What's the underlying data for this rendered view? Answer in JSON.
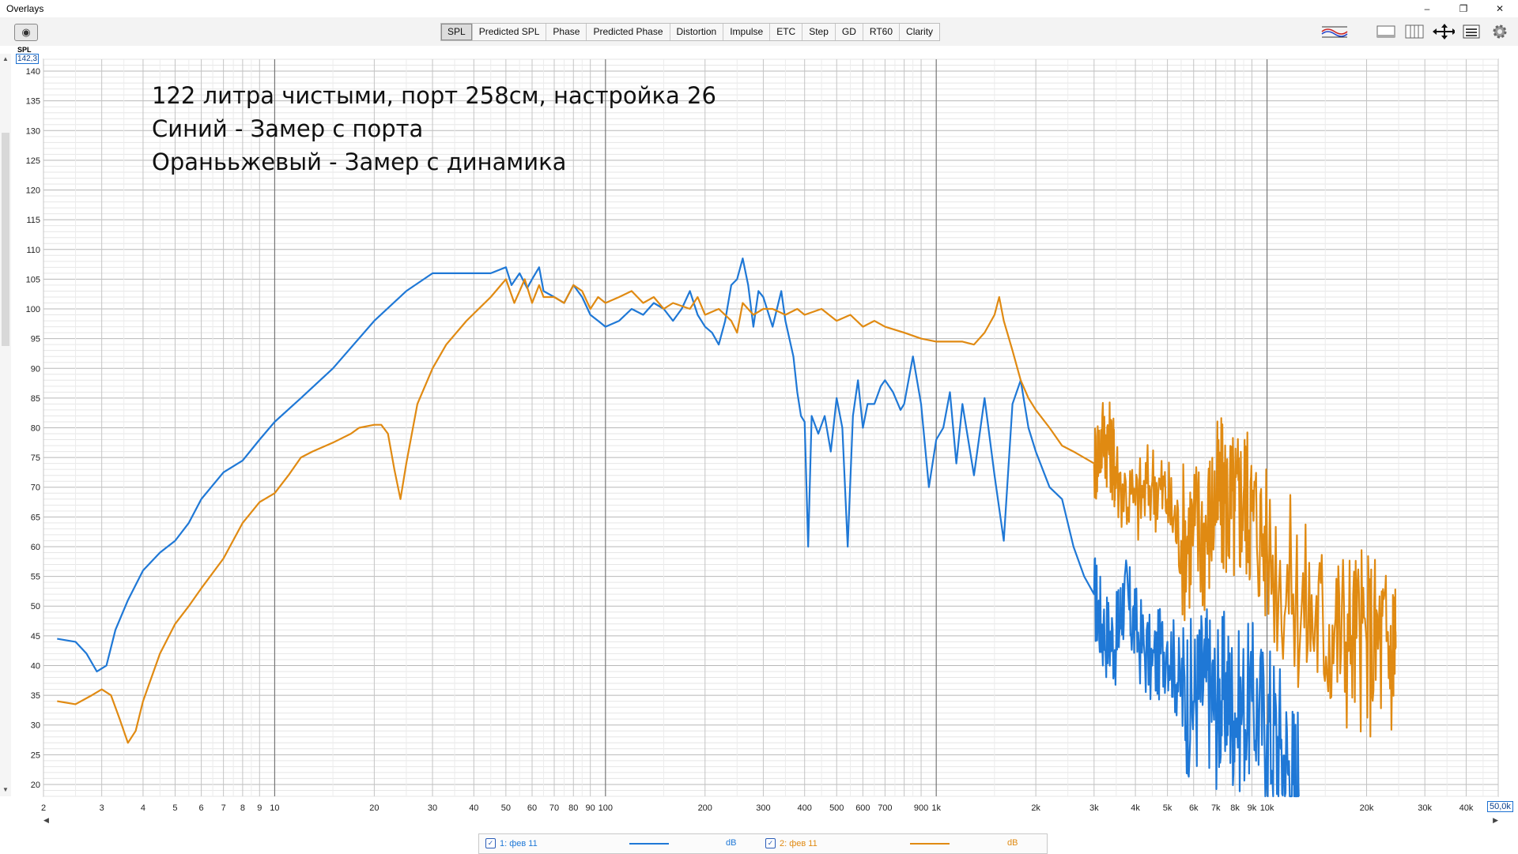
{
  "window": {
    "title": "Overlays",
    "controls": [
      "–",
      "❐",
      "✕"
    ]
  },
  "tabs": [
    {
      "label": "SPL",
      "active": true
    },
    {
      "label": "Predicted SPL"
    },
    {
      "label": "Phase"
    },
    {
      "label": "Predicted Phase"
    },
    {
      "label": "Distortion"
    },
    {
      "label": "Impulse"
    },
    {
      "label": "ETC"
    },
    {
      "label": "Step"
    },
    {
      "label": "GD"
    },
    {
      "label": "RT60"
    },
    {
      "label": "Clarity"
    }
  ],
  "toolbar_icons": [
    "graph-controls-icon",
    "limits-icon",
    "columns-icon",
    "pan-zoom-icon",
    "menu-icon",
    "settings-gear-icon"
  ],
  "y_axis": {
    "label": "SPL",
    "current_max": "142,3"
  },
  "x_axis": {
    "current_max": "50,0k"
  },
  "annotation": [
    "122 литра чистыми, порт 258см, настройка 26",
    "Синий - Замер с порта",
    "Оранььжевый - Замер с динамика"
  ],
  "legend": [
    {
      "label": "1: фев 11",
      "unit": "dB",
      "color": "#1f78d6",
      "checked": true
    },
    {
      "label": "2: фев 11",
      "unit": "dB",
      "color": "#e08a12",
      "checked": true
    }
  ],
  "chart_data": {
    "type": "line",
    "xscale": "log",
    "xlim": [
      2,
      50000
    ],
    "ylim": [
      18,
      142
    ],
    "grid": true,
    "yticks": [
      20,
      25,
      30,
      35,
      40,
      45,
      50,
      55,
      60,
      65,
      70,
      75,
      80,
      85,
      90,
      95,
      100,
      105,
      110,
      115,
      120,
      125,
      130,
      135,
      140
    ],
    "xticks": [
      {
        "v": 2,
        "label": "2"
      },
      {
        "v": 3,
        "label": "3"
      },
      {
        "v": 4,
        "label": "4"
      },
      {
        "v": 5,
        "label": "5"
      },
      {
        "v": 6,
        "label": "6"
      },
      {
        "v": 7,
        "label": "7"
      },
      {
        "v": 8,
        "label": "8"
      },
      {
        "v": 9,
        "label": "9"
      },
      {
        "v": 10,
        "label": "10"
      },
      {
        "v": 20,
        "label": "20"
      },
      {
        "v": 30,
        "label": "30"
      },
      {
        "v": 40,
        "label": "40"
      },
      {
        "v": 50,
        "label": "50"
      },
      {
        "v": 60,
        "label": "60"
      },
      {
        "v": 70,
        "label": "70"
      },
      {
        "v": 80,
        "label": "80"
      },
      {
        "v": 90,
        "label": "90"
      },
      {
        "v": 100,
        "label": "100"
      },
      {
        "v": 200,
        "label": "200"
      },
      {
        "v": 300,
        "label": "300"
      },
      {
        "v": 400,
        "label": "400"
      },
      {
        "v": 500,
        "label": "500"
      },
      {
        "v": 600,
        "label": "600"
      },
      {
        "v": 700,
        "label": "700"
      },
      {
        "v": 900,
        "label": "900"
      },
      {
        "v": 1000,
        "label": "1k"
      },
      {
        "v": 2000,
        "label": "2k"
      },
      {
        "v": 3000,
        "label": "3k"
      },
      {
        "v": 4000,
        "label": "4k"
      },
      {
        "v": 5000,
        "label": "5k"
      },
      {
        "v": 6000,
        "label": "6k"
      },
      {
        "v": 7000,
        "label": "7k"
      },
      {
        "v": 8000,
        "label": "8k"
      },
      {
        "v": 9000,
        "label": "9k"
      },
      {
        "v": 10000,
        "label": "10k"
      },
      {
        "v": 20000,
        "label": "20k"
      },
      {
        "v": 30000,
        "label": "30k"
      },
      {
        "v": 40000,
        "label": "40k"
      }
    ],
    "series": [
      {
        "name": "1: фев 11",
        "color": "#1f78d6",
        "points": [
          [
            2.2,
            44.5
          ],
          [
            2.5,
            44
          ],
          [
            2.7,
            42
          ],
          [
            2.9,
            39
          ],
          [
            3.1,
            40
          ],
          [
            3.3,
            46
          ],
          [
            3.6,
            51
          ],
          [
            4,
            56
          ],
          [
            4.5,
            59
          ],
          [
            5,
            61
          ],
          [
            5.5,
            64
          ],
          [
            6,
            68
          ],
          [
            7,
            72.5
          ],
          [
            8,
            74.5
          ],
          [
            9,
            78
          ],
          [
            10,
            81
          ],
          [
            12,
            85
          ],
          [
            15,
            90
          ],
          [
            20,
            98
          ],
          [
            25,
            103
          ],
          [
            30,
            106
          ],
          [
            40,
            106
          ],
          [
            45,
            106
          ],
          [
            50,
            107
          ],
          [
            52,
            104
          ],
          [
            55,
            106
          ],
          [
            58,
            103.5
          ],
          [
            60,
            105
          ],
          [
            63,
            107
          ],
          [
            65,
            103
          ],
          [
            70,
            102
          ],
          [
            75,
            101
          ],
          [
            80,
            104
          ],
          [
            85,
            102
          ],
          [
            90,
            99
          ],
          [
            95,
            98
          ],
          [
            100,
            97
          ],
          [
            110,
            98
          ],
          [
            120,
            100
          ],
          [
            130,
            99
          ],
          [
            140,
            101
          ],
          [
            150,
            100
          ],
          [
            160,
            98
          ],
          [
            170,
            100
          ],
          [
            180,
            103
          ],
          [
            190,
            99
          ],
          [
            200,
            97
          ],
          [
            210,
            96
          ],
          [
            220,
            94
          ],
          [
            230,
            98
          ],
          [
            240,
            104
          ],
          [
            250,
            105
          ],
          [
            260,
            108.5
          ],
          [
            270,
            104
          ],
          [
            280,
            97
          ],
          [
            290,
            103
          ],
          [
            300,
            102
          ],
          [
            320,
            97
          ],
          [
            340,
            103
          ],
          [
            350,
            98
          ],
          [
            370,
            92
          ],
          [
            380,
            86
          ],
          [
            390,
            82
          ],
          [
            400,
            81
          ],
          [
            410,
            60
          ],
          [
            420,
            82
          ],
          [
            440,
            79
          ],
          [
            460,
            82
          ],
          [
            480,
            76
          ],
          [
            500,
            85
          ],
          [
            520,
            80
          ],
          [
            540,
            60
          ],
          [
            560,
            82
          ],
          [
            580,
            88
          ],
          [
            600,
            80
          ],
          [
            620,
            84
          ],
          [
            650,
            84
          ],
          [
            680,
            87
          ],
          [
            700,
            88
          ],
          [
            740,
            86
          ],
          [
            780,
            83
          ],
          [
            800,
            84
          ],
          [
            850,
            92
          ],
          [
            900,
            84
          ],
          [
            950,
            70
          ],
          [
            1000,
            78
          ],
          [
            1050,
            80
          ],
          [
            1100,
            86
          ],
          [
            1150,
            74
          ],
          [
            1200,
            84
          ],
          [
            1300,
            72
          ],
          [
            1400,
            85
          ],
          [
            1500,
            72
          ],
          [
            1600,
            61
          ],
          [
            1700,
            84
          ],
          [
            1800,
            88
          ],
          [
            1900,
            80
          ],
          [
            2000,
            76
          ],
          [
            2200,
            70
          ],
          [
            2400,
            68
          ],
          [
            2600,
            60
          ],
          [
            2800,
            55
          ],
          [
            3000,
            52
          ],
          [
            3200,
            46
          ],
          [
            3500,
            44
          ],
          [
            3700,
            52
          ],
          [
            4000,
            46
          ],
          [
            4500,
            40
          ],
          [
            5000,
            44
          ],
          [
            5500,
            36
          ],
          [
            6000,
            34
          ],
          [
            6500,
            38
          ],
          [
            7000,
            33
          ],
          [
            7500,
            36
          ],
          [
            8000,
            32
          ],
          [
            9000,
            34
          ],
          [
            10000,
            30
          ],
          [
            11000,
            26
          ],
          [
            12000,
            20
          ],
          [
            12500,
            18
          ]
        ]
      },
      {
        "name": "2: фев 11",
        "color": "#e08a12",
        "points": [
          [
            2.2,
            34
          ],
          [
            2.5,
            33.5
          ],
          [
            2.8,
            35
          ],
          [
            3,
            36
          ],
          [
            3.2,
            35
          ],
          [
            3.4,
            31
          ],
          [
            3.6,
            27
          ],
          [
            3.8,
            29
          ],
          [
            4,
            34
          ],
          [
            4.5,
            42
          ],
          [
            5,
            47
          ],
          [
            5.5,
            50
          ],
          [
            6,
            53
          ],
          [
            7,
            58
          ],
          [
            8,
            64
          ],
          [
            9,
            67.5
          ],
          [
            10,
            69
          ],
          [
            11,
            72
          ],
          [
            12,
            75
          ],
          [
            13,
            76
          ],
          [
            15,
            77.5
          ],
          [
            17,
            79
          ],
          [
            18,
            80
          ],
          [
            20,
            80.5
          ],
          [
            21,
            80.5
          ],
          [
            22,
            79
          ],
          [
            23,
            73
          ],
          [
            24,
            68
          ],
          [
            25,
            74
          ],
          [
            27,
            84
          ],
          [
            30,
            90
          ],
          [
            33,
            94
          ],
          [
            38,
            98
          ],
          [
            45,
            102
          ],
          [
            50,
            105
          ],
          [
            53,
            101
          ],
          [
            55,
            103
          ],
          [
            57,
            105
          ],
          [
            60,
            101
          ],
          [
            63,
            104
          ],
          [
            65,
            102
          ],
          [
            70,
            102
          ],
          [
            75,
            101
          ],
          [
            80,
            104
          ],
          [
            85,
            103
          ],
          [
            90,
            100
          ],
          [
            95,
            102
          ],
          [
            100,
            101
          ],
          [
            110,
            102
          ],
          [
            120,
            103
          ],
          [
            130,
            101
          ],
          [
            140,
            102
          ],
          [
            150,
            100
          ],
          [
            160,
            101
          ],
          [
            180,
            100
          ],
          [
            190,
            102
          ],
          [
            200,
            99
          ],
          [
            220,
            100
          ],
          [
            240,
            98
          ],
          [
            250,
            96
          ],
          [
            260,
            101
          ],
          [
            280,
            99
          ],
          [
            300,
            100
          ],
          [
            320,
            100
          ],
          [
            350,
            99
          ],
          [
            380,
            100
          ],
          [
            400,
            99
          ],
          [
            450,
            100
          ],
          [
            500,
            98
          ],
          [
            550,
            99
          ],
          [
            600,
            97
          ],
          [
            650,
            98
          ],
          [
            700,
            97
          ],
          [
            800,
            96
          ],
          [
            900,
            95
          ],
          [
            1000,
            94.5
          ],
          [
            1200,
            94.5
          ],
          [
            1300,
            94
          ],
          [
            1400,
            96
          ],
          [
            1500,
            99
          ],
          [
            1550,
            102
          ],
          [
            1600,
            98
          ],
          [
            1700,
            93
          ],
          [
            1800,
            88
          ],
          [
            1900,
            85
          ],
          [
            2000,
            83
          ],
          [
            2200,
            80
          ],
          [
            2400,
            77
          ],
          [
            2600,
            76
          ],
          [
            3000,
            74
          ],
          [
            3200,
            79
          ],
          [
            3400,
            76
          ],
          [
            3500,
            72
          ],
          [
            4000,
            67
          ],
          [
            4500,
            71
          ],
          [
            5000,
            68
          ],
          [
            5500,
            61
          ],
          [
            6000,
            63
          ],
          [
            6500,
            62
          ],
          [
            7000,
            68
          ],
          [
            7500,
            68
          ],
          [
            8000,
            66
          ],
          [
            8500,
            69
          ],
          [
            9000,
            66
          ],
          [
            10000,
            60
          ],
          [
            12000,
            52
          ],
          [
            14000,
            48
          ],
          [
            16000,
            46
          ],
          [
            18000,
            45
          ],
          [
            20000,
            44
          ],
          [
            22000,
            44
          ],
          [
            24000,
            43
          ],
          [
            24500,
            43
          ]
        ]
      }
    ]
  }
}
